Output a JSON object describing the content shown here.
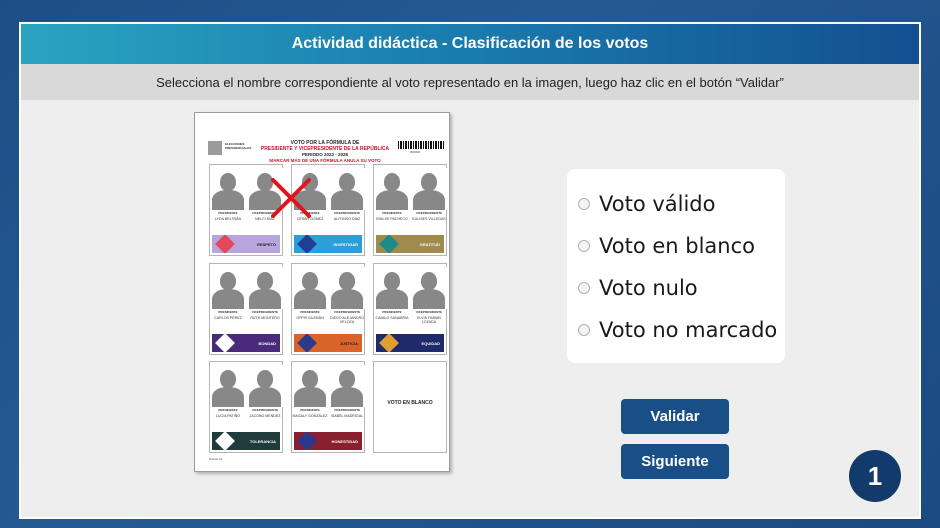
{
  "title": "Actividad didáctica - Clasificación de los votos",
  "instructions": "Selecciona el nombre correspondiente al voto representado en la imagen, luego haz clic en el botón “Validar”",
  "ballot": {
    "org": "ELECCIONES PRESIDENCIALES",
    "heading1": "VOTO POR LA FÓRMULA DE",
    "heading2": "PRESIDENTE Y VICEPRESIDENTE DE LA REPÚBLICA",
    "heading3": "PERIODO 2022 - 2026",
    "warning": "MARCAR MÁS DE UNA FÓRMULA ANULA SU VOTO",
    "code": "000000",
    "role_president": "PRESIDENTE",
    "role_vice": "VICEPRESIDENTE",
    "blank_vote": "VOTO EN BLANCO",
    "footer": "Diseño 01",
    "candidates": [
      {
        "president": "LYDA BELTRÁN",
        "vice": "NELCI DÍAZ",
        "party": "RESPETO",
        "color": "#b8a5e0",
        "shape_color": "#e04a5a",
        "text_color": "#222"
      },
      {
        "president": "CÉSAR GÓMEZ",
        "vice": "ALFONSO DÍAZ",
        "party": "INVESTIGAR",
        "color": "#2a9fd8",
        "shape_color": "#1f3e94",
        "text_color": "#ffffff"
      },
      {
        "president": "EMILSE PACHECO",
        "vice": "EULISES VILLEGAS",
        "party": "GRATITUD",
        "color": "#a08a4c",
        "shape_color": "#1f8a8a",
        "text_color": "#ffffff"
      },
      {
        "president": "CARLOS PÉREZ",
        "vice": "RUTH MONTERO",
        "party": "BONDAD",
        "color": "#4a2a7a",
        "shape_color": "#ffffff",
        "text_color": "#ffffff"
      },
      {
        "president": "OFFIR GUZMÁN",
        "vice": "DIEGO ALEJANDRO VELOZA",
        "party": "JUSTICIA",
        "color": "#d9632a",
        "shape_color": "#2d3a8a",
        "text_color": "#222"
      },
      {
        "president": "CAMILO SANABRIA",
        "vice": "ELVIS FABIAN LOZADA",
        "party": "EQUIDAD",
        "color": "#1f2a6b",
        "shape_color": "#e0a030",
        "text_color": "#ffffff"
      },
      {
        "president": "LUCIA PATIÑO",
        "vice": "JACOBO MENDEZ",
        "party": "TOLERANCIA",
        "color": "#1f3b3b",
        "shape_color": "#ffffff",
        "text_color": "#ffffff"
      },
      {
        "president": "MAGALY GONZÁLEZ",
        "vice": "ISABEL MADRIGAL",
        "party": "HONESTIDAD",
        "color": "#8a1f2f",
        "shape_color": "#2a3a8a",
        "text_color": "#ffffff"
      }
    ]
  },
  "options": [
    {
      "label": "Voto válido"
    },
    {
      "label": "Voto en blanco"
    },
    {
      "label": "Voto nulo"
    },
    {
      "label": "Voto no marcado"
    }
  ],
  "buttons": {
    "validate": "Validar",
    "next": "Siguiente"
  },
  "page_number": "1",
  "colors": {
    "accent": "#174f86",
    "mark": "#e0141e"
  }
}
